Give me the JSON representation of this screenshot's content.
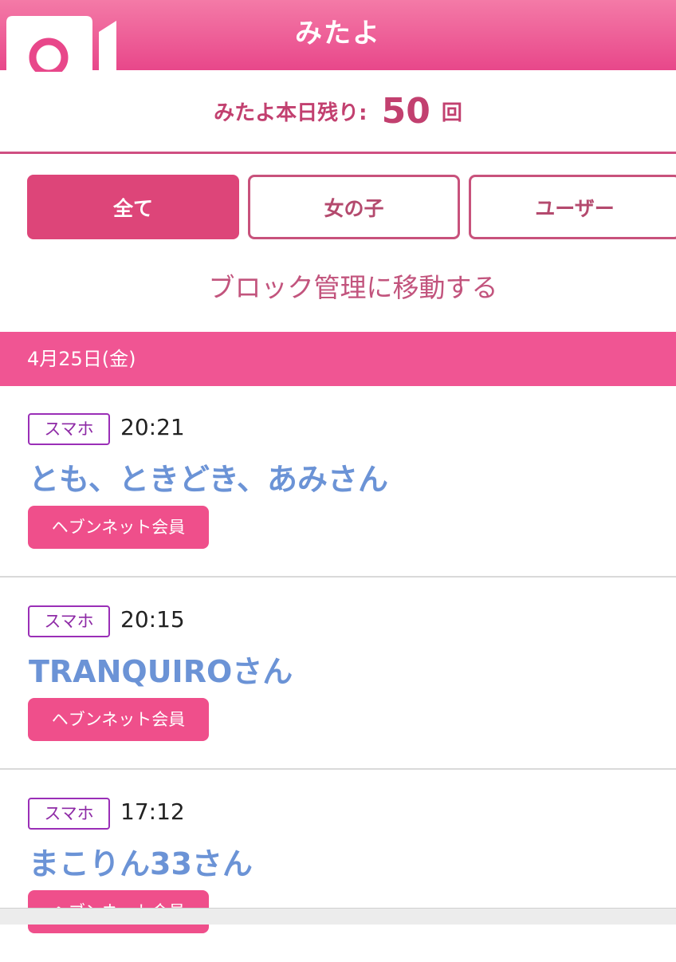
{
  "header": {
    "title": "みたよ",
    "icon": "camera-icon"
  },
  "remaining": {
    "label": "みたよ本日残り:",
    "count": "50",
    "unit": "回"
  },
  "tabs": [
    {
      "label": "全て",
      "active": true
    },
    {
      "label": "女の子",
      "active": false
    },
    {
      "label": "ユーザー",
      "active": false
    }
  ],
  "block_link": "ブロック管理に移動する",
  "date_label": "4月25日(金)",
  "entries": [
    {
      "device": "スマホ",
      "time": "20:21",
      "name": "とも、ときどき、あみさん",
      "badge": "ヘブンネット会員"
    },
    {
      "device": "スマホ",
      "time": "20:15",
      "name": "TRANQUIROさん",
      "badge": "ヘブンネット会員"
    },
    {
      "device": "スマホ",
      "time": "17:12",
      "name": "まこりん33さん",
      "badge": "ヘブンネット会員"
    }
  ],
  "colors": {
    "header": "#e8478a",
    "accent": "#dd4579",
    "date_bar": "#f05593",
    "name_text": "#6b93d6",
    "device_border": "#9a2fb7"
  }
}
